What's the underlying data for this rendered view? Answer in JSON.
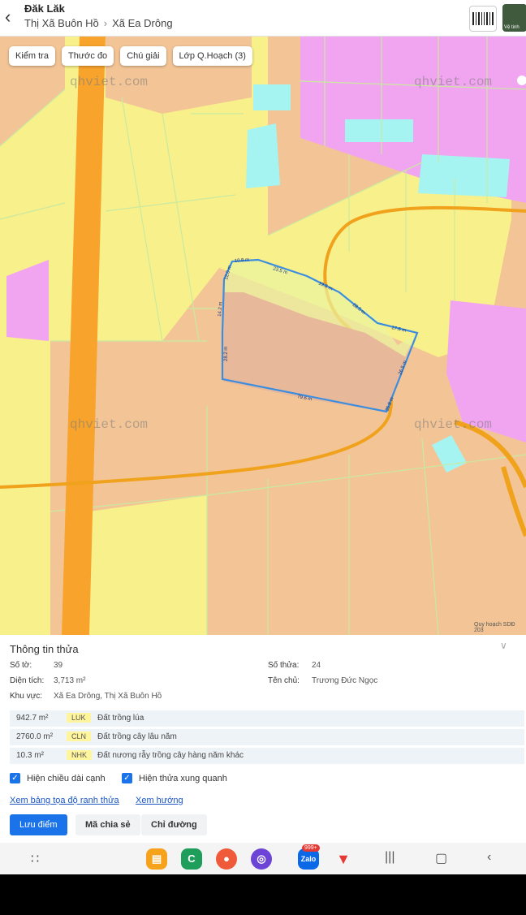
{
  "header": {
    "province": "Đăk Lăk",
    "breadcrumb": [
      "Thị Xã Buôn Hồ",
      "Xã Ea Drông"
    ],
    "thumb_label": "Vệ tinh"
  },
  "toolbar": [
    "Kiểm tra",
    "Thước đo",
    "Chú giải",
    "Lớp Q.Hoạch (3)"
  ],
  "map": {
    "watermark": "qhviet.com",
    "credit": "Quy hoạch SDĐ 203",
    "edge_labels": [
      "10.8 m",
      "23.5 m",
      "19.8 m",
      "28.5 m",
      "17.6 m",
      "26.5 m",
      "35.8 m",
      "79.6 m",
      "28.2 m",
      "14.2 m",
      "12.0 m"
    ],
    "colors": {
      "rice": "#f8f08a",
      "perennial": "#f3c596",
      "residential": "#f1a5f0",
      "water": "#a6f4f2",
      "road": "#f7a32c",
      "boundary": "#3b8de0"
    }
  },
  "info": {
    "title": "Thông tin thửa",
    "so_to_label": "Số tờ:",
    "so_to": "39",
    "so_thua_label": "Số thửa:",
    "so_thua": "24",
    "dien_tich_label": "Diện tích:",
    "dien_tich": "3,713 m²",
    "ten_chu_label": "Tên chủ:",
    "ten_chu": "Trương Đức Ngọc",
    "khu_vuc_label": "Khu vực:",
    "khu_vuc": "Xã Ea Drông, Thị Xã Buôn Hồ",
    "land_uses": [
      {
        "area": "942.7 m²",
        "code": "LUK",
        "desc": "Đất trồng lúa"
      },
      {
        "area": "2760.0 m²",
        "code": "CLN",
        "desc": "Đất trồng cây lâu năm"
      },
      {
        "area": "10.3 m²",
        "code": "NHK",
        "desc": "Đất nương rẫy trồng cây hàng năm khác"
      }
    ],
    "check_edges": "Hiện chiều dài cạnh",
    "check_neighbors": "Hiện thửa xung quanh",
    "link_coords": "Xem bảng tọa độ ranh thửa",
    "link_direction": "Xem hướng",
    "btn_save": "Lưu điểm",
    "btn_share": "Mã chia sẻ",
    "btn_route": "Chỉ đường"
  },
  "navbar": {
    "zalo_badge": "999+",
    "zalo_label": "Zalo",
    "icons": [
      "apps-grid-icon",
      "files-icon",
      "phone-icon",
      "contacts-icon",
      "browser-icon",
      "zalo-icon",
      "maps-icon",
      "recents-icon",
      "home-icon",
      "back-icon"
    ]
  }
}
